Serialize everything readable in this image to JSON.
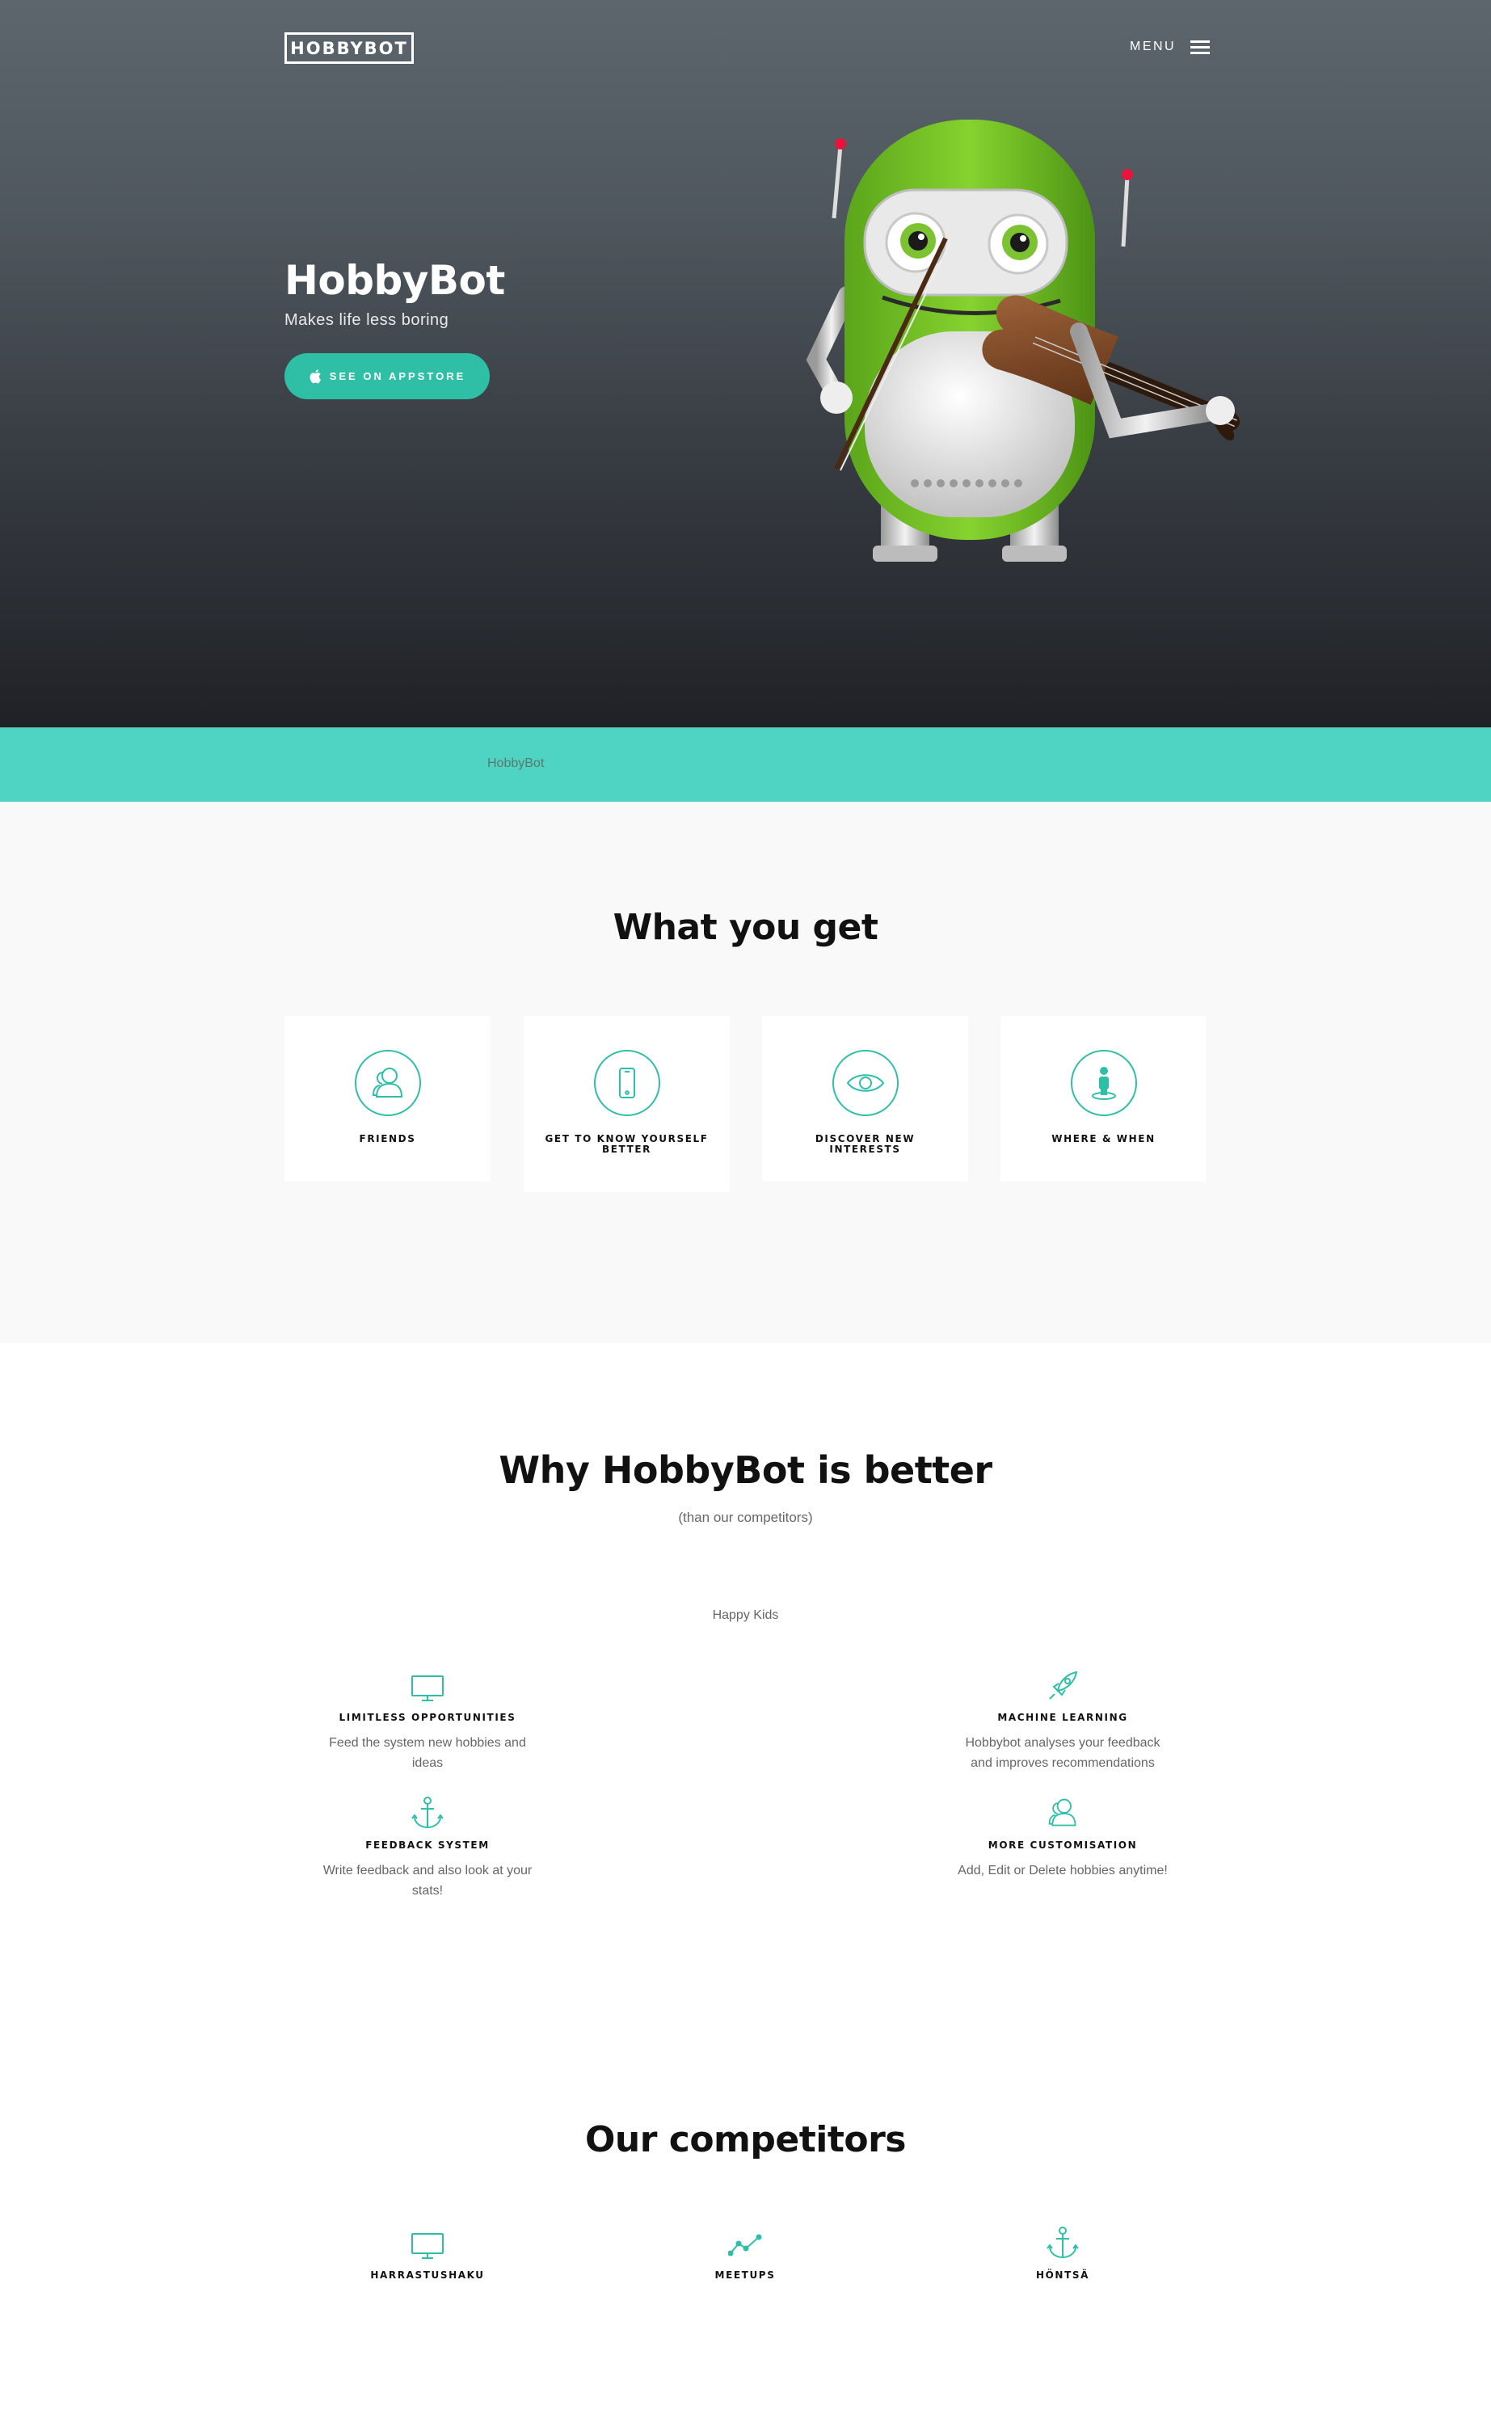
{
  "header": {
    "logo_text": "HOBBYBOT",
    "menu_label": "MENU"
  },
  "hero": {
    "title": "HobbyBot",
    "subtitle": "Makes life less boring",
    "cta_label": "SEE ON APPSTORE",
    "cta_icon": "apple-icon"
  },
  "band": {
    "text": "HobbyBot"
  },
  "features": {
    "title": "What you get",
    "cards": [
      {
        "label": "FRIENDS",
        "icon": "users-icon"
      },
      {
        "label": "GET TO KNOW YOURSELF BETTER",
        "icon": "mobile-phone-icon"
      },
      {
        "label": "DISCOVER NEW INTERESTS",
        "icon": "eye-icon"
      },
      {
        "label": "WHERE & WHEN",
        "icon": "location-person-icon"
      }
    ]
  },
  "why": {
    "title": "Why HobbyBot is better",
    "subtitle": "(than our competitors)",
    "caption": "Happy Kids",
    "items": [
      {
        "title": "LIMITLESS OPPORTUNITIES",
        "text": "Feed the system new hobbies and ideas",
        "icon": "monitor-icon"
      },
      {
        "title": "MACHINE LEARNING",
        "text": "Hobbybot analyses your feedback and improves recommendations",
        "icon": "rocket-icon"
      },
      {
        "title": "FEEDBACK SYSTEM",
        "text": "Write feedback and also look at your stats!",
        "icon": "anchor-icon"
      },
      {
        "title": "MORE CUSTOMISATION",
        "text": "Add, Edit or Delete hobbies anytime!",
        "icon": "users-icon"
      }
    ]
  },
  "competitors": {
    "title": "Our competitors",
    "items": [
      {
        "title": "HARRASTUSHAKU",
        "icon": "monitor-icon"
      },
      {
        "title": "MEETUPS",
        "icon": "trend-line-icon"
      },
      {
        "title": "HÖNTSÄ",
        "icon": "anchor-icon"
      }
    ]
  },
  "colors": {
    "accent": "#2fbfa7",
    "band": "#4fd3c2",
    "robot_green": "#7dc82a"
  }
}
